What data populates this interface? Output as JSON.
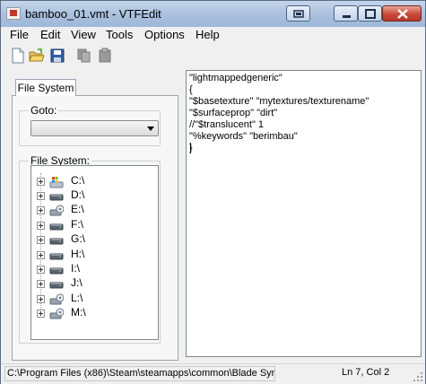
{
  "window": {
    "title": "bamboo_01.vmt - VTFEdit"
  },
  "menu": [
    {
      "label": "File"
    },
    {
      "label": "Edit"
    },
    {
      "label": "View"
    },
    {
      "label": "Tools"
    },
    {
      "label": "Options"
    },
    {
      "label": "Help"
    }
  ],
  "toolbar": {
    "icons": [
      "new-file-icon",
      "open-folder-icon",
      "save-disk-icon",
      "copy-icon",
      "paste-icon"
    ]
  },
  "left_panel": {
    "tab_label": "File System",
    "goto_label": "Goto:",
    "goto_value": "",
    "fs_label": "File System:",
    "drives": [
      {
        "label": "C:\\",
        "icon": "windows-drive-icon"
      },
      {
        "label": "D:\\",
        "icon": "hard-drive-icon"
      },
      {
        "label": "E:\\",
        "icon": "network-drive-icon"
      },
      {
        "label": "F:\\",
        "icon": "hard-drive-icon"
      },
      {
        "label": "G:\\",
        "icon": "hard-drive-icon"
      },
      {
        "label": "H:\\",
        "icon": "hard-drive-icon"
      },
      {
        "label": "I:\\",
        "icon": "hard-drive-icon"
      },
      {
        "label": "J:\\",
        "icon": "hard-drive-icon"
      },
      {
        "label": "L:\\",
        "icon": "network-drive-icon"
      },
      {
        "label": "M:\\",
        "icon": "network-drive-icon"
      }
    ]
  },
  "editor": {
    "lines": [
      "\"lightmappedgeneric\"",
      "{",
      "\"$basetexture\" \"mytextures/texturename\"",
      "\"$surfaceprop\" \"dirt\"",
      "//\"$translucent\" 1",
      "\"%keywords\" \"berimbau\"",
      "}"
    ]
  },
  "status": {
    "path": "C:\\Program Files (x86)\\Steam\\steamapps\\common\\Blade Sym",
    "position": "Ln 7, Col 2"
  }
}
